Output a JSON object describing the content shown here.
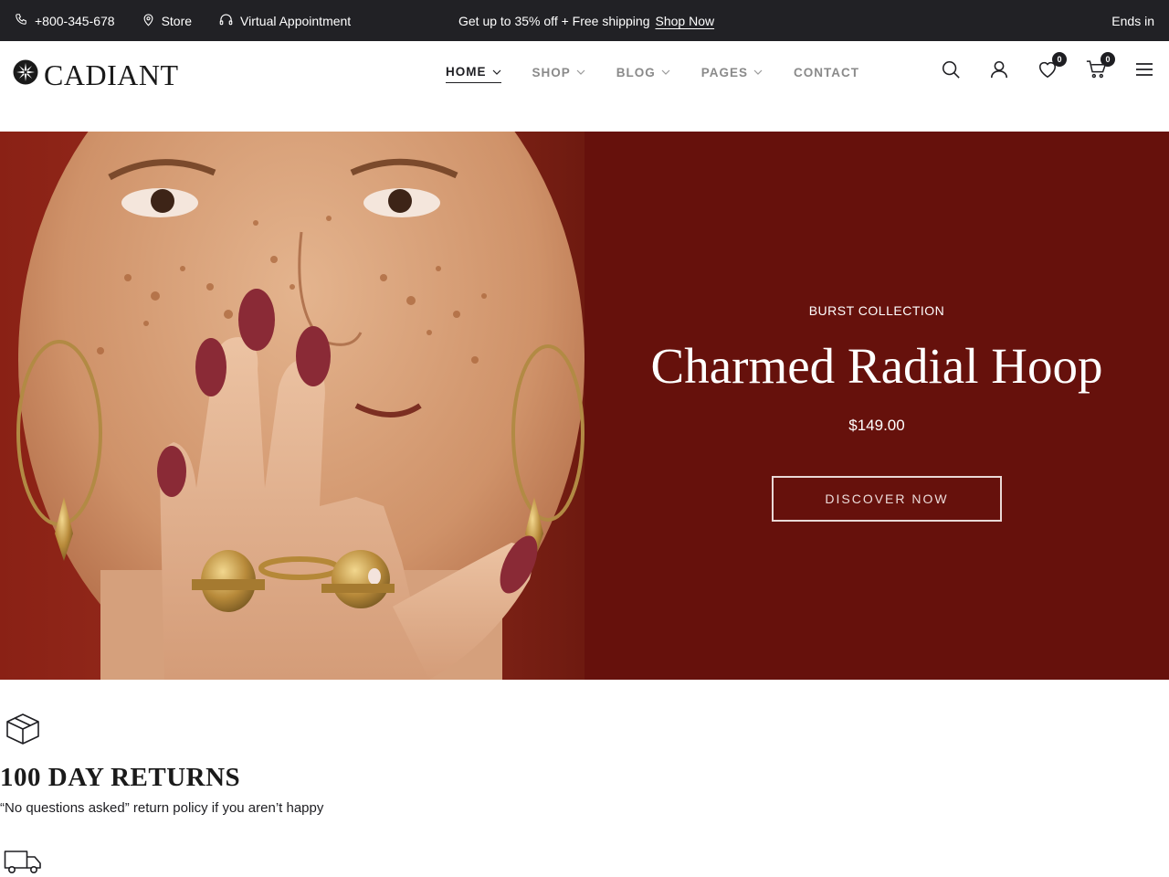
{
  "topbar": {
    "phone": "+800-345-678",
    "store": "Store",
    "appointment": "Virtual Appointment",
    "promo": "Get up to 35% off + Free shipping",
    "promo_link": "Shop Now",
    "countdown": "Ends in"
  },
  "header": {
    "logo": "CADIANT",
    "nav": [
      {
        "label": "HOME"
      },
      {
        "label": "SHOP"
      },
      {
        "label": "BLOG"
      },
      {
        "label": "PAGES"
      },
      {
        "label": "CONTACT"
      }
    ],
    "wishlist_count": "0",
    "cart_count": "0"
  },
  "hero": {
    "subtitle": "BURST COLLECTION",
    "title": "Charmed Radial Hoop",
    "price": "$149.00",
    "button": "DISCOVER NOW",
    "panel_color": "#66110c"
  },
  "features": [
    {
      "icon": "box-icon",
      "title": "100 DAY RETURNS",
      "desc": "“No questions asked” return policy if you aren’t happy"
    },
    {
      "icon": "truck-icon",
      "title": "",
      "desc": ""
    }
  ]
}
